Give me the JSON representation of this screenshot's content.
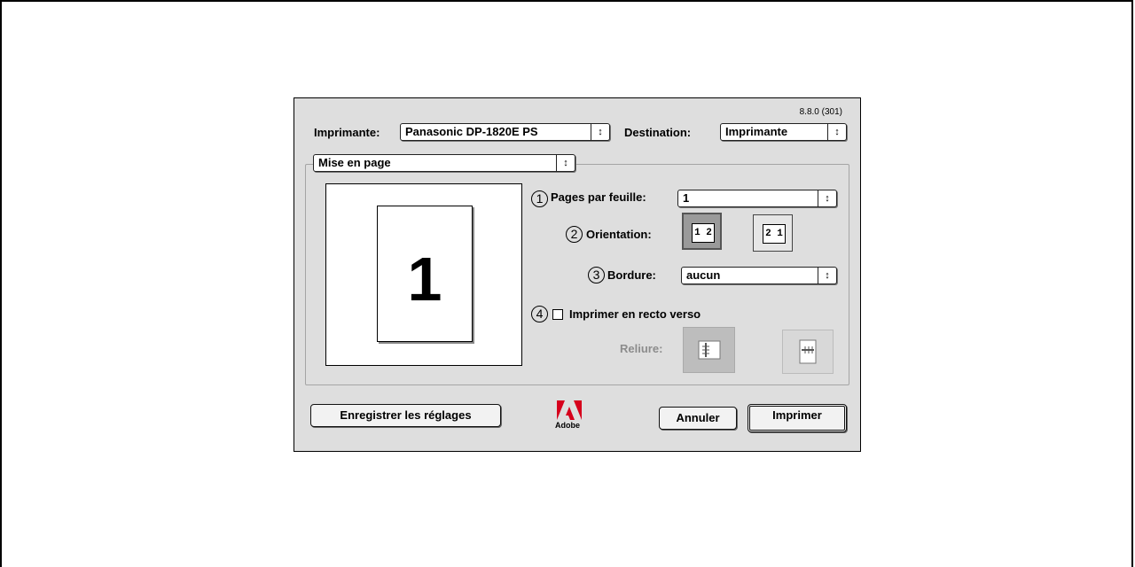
{
  "dialog": {
    "version": "8.8.0 (301)",
    "printer_label": "Imprimante:",
    "printer_value": "Panasonic DP-1820E PS",
    "destination_label": "Destination:",
    "destination_value": "Imprimante",
    "panel_value": "Mise en page",
    "popup_arrows": "↕"
  },
  "preview": {
    "page_number": "1"
  },
  "layout": {
    "marker1": "1",
    "pages_label": "Pages par feuille:",
    "pages_value": "1",
    "marker2": "2",
    "orientation_label": "Orientation:",
    "orient_lr": "1 2",
    "orient_rl": "2 1",
    "marker3": "3",
    "border_label": "Bordure:",
    "border_value": "aucun",
    "marker4": "4",
    "duplex_label": "Imprimer en recto verso",
    "binding_label": "Reliure:"
  },
  "buttons": {
    "save_settings": "Enregistrer les réglages",
    "adobe": "Adobe",
    "cancel": "Annuler",
    "print": "Imprimer"
  },
  "colors": {
    "dialog_bg": "#dedede",
    "adobe_red": "#d6001c"
  }
}
